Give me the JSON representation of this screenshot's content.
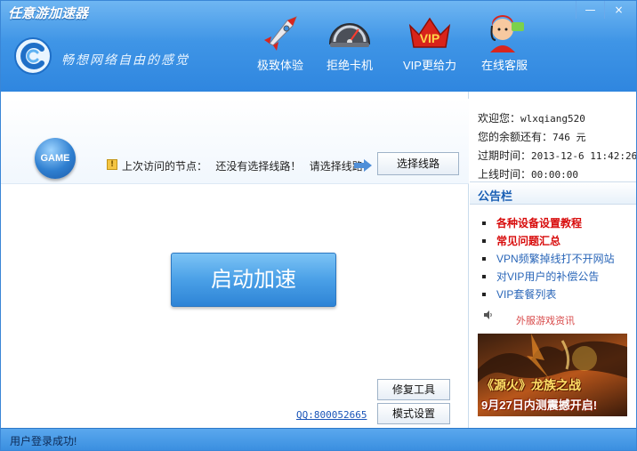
{
  "window": {
    "title": "任意游加速器",
    "minimize_label": "—",
    "close_label": "×"
  },
  "header": {
    "slogan": "畅想网络自由的感觉",
    "nav": [
      {
        "label": "极致体验",
        "icon": "rocket-icon"
      },
      {
        "label": "拒绝卡机",
        "icon": "speedometer-icon"
      },
      {
        "label": "VIP更给力",
        "icon": "vip-icon"
      },
      {
        "label": "在线客服",
        "icon": "customer-service-icon"
      }
    ],
    "vip_icon_text": "VIP"
  },
  "main": {
    "game_badge": "GAME",
    "last_node_label": "上次访问的节点：",
    "last_node_value": "还没有选择线路！",
    "choose_prompt": "请选择线路",
    "choose_route_button": "选择线路",
    "start_button": "启动加速",
    "repair_button": "修复工具",
    "mode_button": "模式设置",
    "qq_link": "QQ:800052665"
  },
  "user": {
    "welcome": "欢迎您：",
    "username": "wlxqiang520",
    "balance_label": "您的余额还有：",
    "balance_value": "746 元",
    "expire_label": "过期时间：",
    "expire_value": "2013-12-6 11:42:26",
    "online_label": "上线时间：",
    "online_value": "00:00:00"
  },
  "notice": {
    "title": "公告栏",
    "items": [
      {
        "text": "各种设备设置教程",
        "style": "red"
      },
      {
        "text": "常见问题汇总",
        "style": "red"
      },
      {
        "text": "VPN频繁掉线打不开网站",
        "style": "blue"
      },
      {
        "text": "对VIP用户的补偿公告",
        "style": "blue"
      },
      {
        "text": "VIP套餐列表",
        "style": "blue"
      }
    ],
    "ticker": "外服游戏资讯"
  },
  "ad": {
    "title": "《源火》龙族之战",
    "subtitle": "9月27日内测震撼开启!"
  },
  "status": {
    "text": "用户登录成功!"
  },
  "colors": {
    "header_blue": "#3f95e6",
    "accent_red": "#d80c0c",
    "link_blue": "#2a66b8"
  }
}
